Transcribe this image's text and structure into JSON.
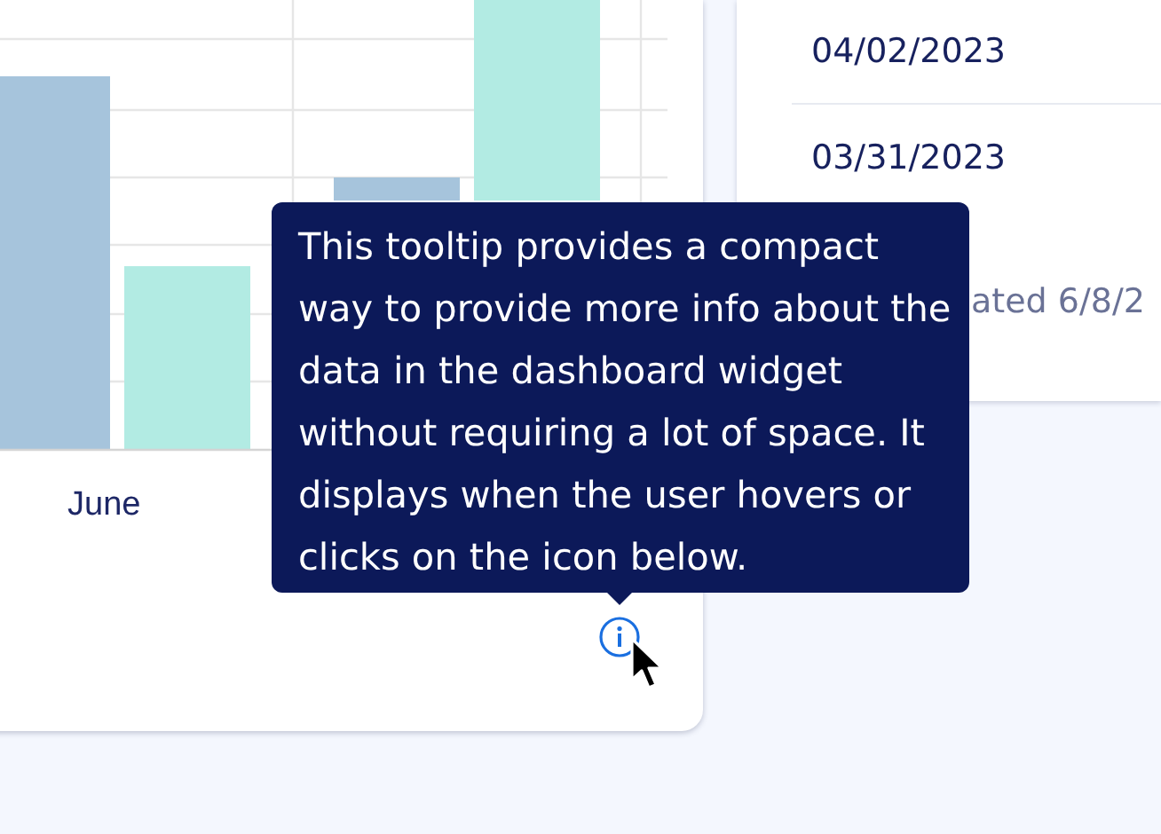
{
  "chart": {
    "category_label": "June"
  },
  "tooltip": {
    "text": "This tooltip provides a compact way to provide more info about the data in the dashboard widget without requiring a lot of space. It displays when the user hovers or clicks on the icon below."
  },
  "dates": [
    "04/02/2023",
    "03/31/2023"
  ],
  "updated_note": "ated 6/8/2"
}
